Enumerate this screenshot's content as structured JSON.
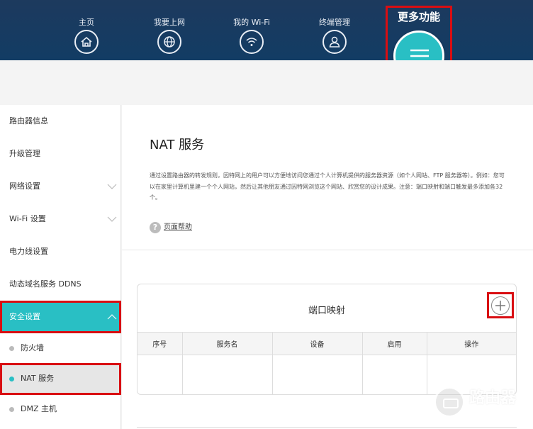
{
  "nav": {
    "items": [
      {
        "label": "主页",
        "icon": "home-icon"
      },
      {
        "label": "我要上网",
        "icon": "globe-icon"
      },
      {
        "label": "我的 Wi-Fi",
        "icon": "wifi-icon"
      },
      {
        "label": "终端管理",
        "icon": "user-icon"
      }
    ],
    "more_label": "更多功能",
    "more_icon": "menu-icon"
  },
  "sidebar": {
    "items": [
      {
        "label": "路由器信息"
      },
      {
        "label": "升级管理"
      },
      {
        "label": "网络设置"
      },
      {
        "label": "Wi-Fi 设置"
      },
      {
        "label": "电力线设置"
      },
      {
        "label": "动态域名服务 DDNS"
      },
      {
        "label": "安全设置"
      }
    ],
    "subitems": [
      {
        "label": "防火墙"
      },
      {
        "label": "NAT 服务"
      },
      {
        "label": "DMZ 主机"
      }
    ]
  },
  "main": {
    "title": "NAT 服务",
    "description": "通过设置路由器的转发规则，因特网上的用户可以方便地访问您通过个人计算机提供的服务器资源（如个人网站、FTP 服务器等）。例如：您可以在家里计算机里建一个个人网站，然后让其他朋友通过因特网浏览这个网站、欣赏您的设计成果。注意：端口映射和端口触发最多添加各32个。",
    "help_label": "页面帮助",
    "help_icon_glyph": "?"
  },
  "port_mapping": {
    "title": "端口映射",
    "columns": [
      "序号",
      "服务名",
      "设备",
      "启用",
      "操作"
    ]
  },
  "watermark": {
    "text": "路由器",
    "sub": "luyouqi.com"
  },
  "colors": {
    "accent": "#29bfc4",
    "topbar": "#1d3a5e",
    "highlight_box": "#d90e12"
  }
}
